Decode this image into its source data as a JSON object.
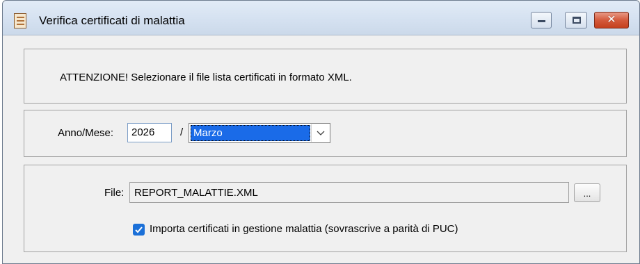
{
  "window": {
    "title": "Verifica certificati di malattia",
    "icon": "document-icon"
  },
  "warning": {
    "text": "ATTENZIONE!  Selezionare il file lista certificati in formato XML."
  },
  "period": {
    "label": "Anno/Mese:",
    "year": "2026",
    "separator": "/",
    "month": "Marzo"
  },
  "file": {
    "label": "File:",
    "value": "REPORT_MALATTIE.XML",
    "browse_label": "..."
  },
  "import_option": {
    "checked": true,
    "label": "Importa certificati in gestione malattia (sovrascrive a parità di PUC)"
  },
  "colors": {
    "selection": "#1a6be8",
    "checkbox": "#1b70d8",
    "close_button": "#d45a3c"
  }
}
